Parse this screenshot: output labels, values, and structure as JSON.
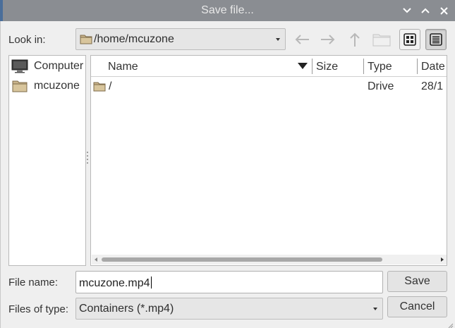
{
  "window": {
    "title": "Save file...",
    "controls": {
      "minimize": "chevron-down-icon",
      "maximize": "chevron-up-icon",
      "close": "close-icon"
    }
  },
  "look_in": {
    "label": "Look in:",
    "path": "/home/mcuzone",
    "icon": "folder-icon"
  },
  "toolbar": {
    "buttons": [
      "back-arrow-icon",
      "forward-arrow-icon",
      "up-arrow-icon",
      "new-folder-icon",
      "icon-view-icon",
      "detail-view-icon"
    ],
    "active_view": "detail"
  },
  "sidebar": {
    "items": [
      {
        "label": "Computer",
        "icon": "computer-icon"
      },
      {
        "label": "mcuzone",
        "icon": "folder-icon"
      }
    ]
  },
  "file_list": {
    "columns": [
      "Name",
      "Size",
      "Type",
      "Date"
    ],
    "sort": {
      "column": "Name",
      "direction": "descending"
    },
    "rows": [
      {
        "name": "/",
        "size": "",
        "type": "Drive",
        "date": "28/1",
        "icon": "folder-icon"
      }
    ]
  },
  "form": {
    "file_name_label": "File name:",
    "file_name_value": "mcuzone.mp4",
    "file_type_label": "Files of type:",
    "file_type_value": "Containers (*.mp4)"
  },
  "buttons": {
    "save": "Save",
    "cancel": "Cancel"
  },
  "colors": {
    "titlebar": "#8a8d92",
    "dialog_bg": "#efefef",
    "folder": "#c9b48c"
  }
}
